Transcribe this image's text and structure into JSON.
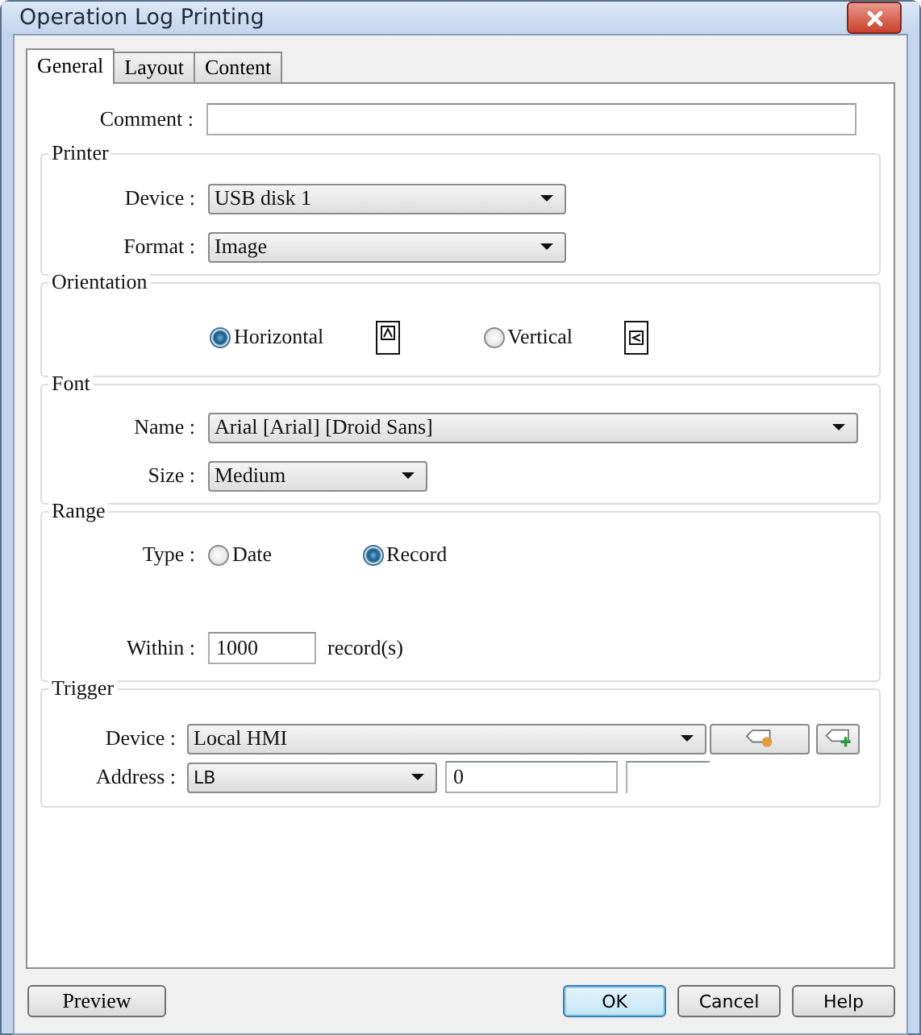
{
  "window": {
    "title": "Operation Log Printing"
  },
  "tabs": [
    {
      "label": "General",
      "selected": true
    },
    {
      "label": "Layout",
      "selected": false
    },
    {
      "label": "Content",
      "selected": false
    }
  ],
  "comment": {
    "label": "Comment :"
  },
  "printer": {
    "title": "Printer",
    "device": {
      "label": "Device :",
      "value": "USB disk 1"
    },
    "format": {
      "label": "Format :",
      "value": "Image"
    }
  },
  "orientation": {
    "title": "Orientation",
    "options": [
      {
        "label": "Horizontal",
        "selected": true
      },
      {
        "label": "Vertical",
        "selected": false
      }
    ]
  },
  "font": {
    "title": "Font",
    "name": {
      "label": "Name :",
      "value": "Arial [Arial] [Droid Sans]"
    },
    "size": {
      "label": "Size :",
      "value": "Medium"
    }
  },
  "range": {
    "title": "Range",
    "type": {
      "label": "Type :",
      "options": [
        {
          "label": "Date",
          "selected": false
        },
        {
          "label": "Record",
          "selected": true
        }
      ]
    },
    "within": {
      "label": "Within :",
      "value": "1000",
      "unit": "record(s)"
    }
  },
  "trigger": {
    "title": "Trigger",
    "device": {
      "label": "Device :",
      "value": "Local HMI"
    },
    "address": {
      "label": "Address :",
      "device_type": "LB",
      "value": "0"
    }
  },
  "buttons": [
    {
      "label": "Preview",
      "default": false
    },
    {
      "label": "OK",
      "default": true
    },
    {
      "label": "Cancel",
      "default": false
    },
    {
      "label": "Help",
      "default": false
    }
  ]
}
